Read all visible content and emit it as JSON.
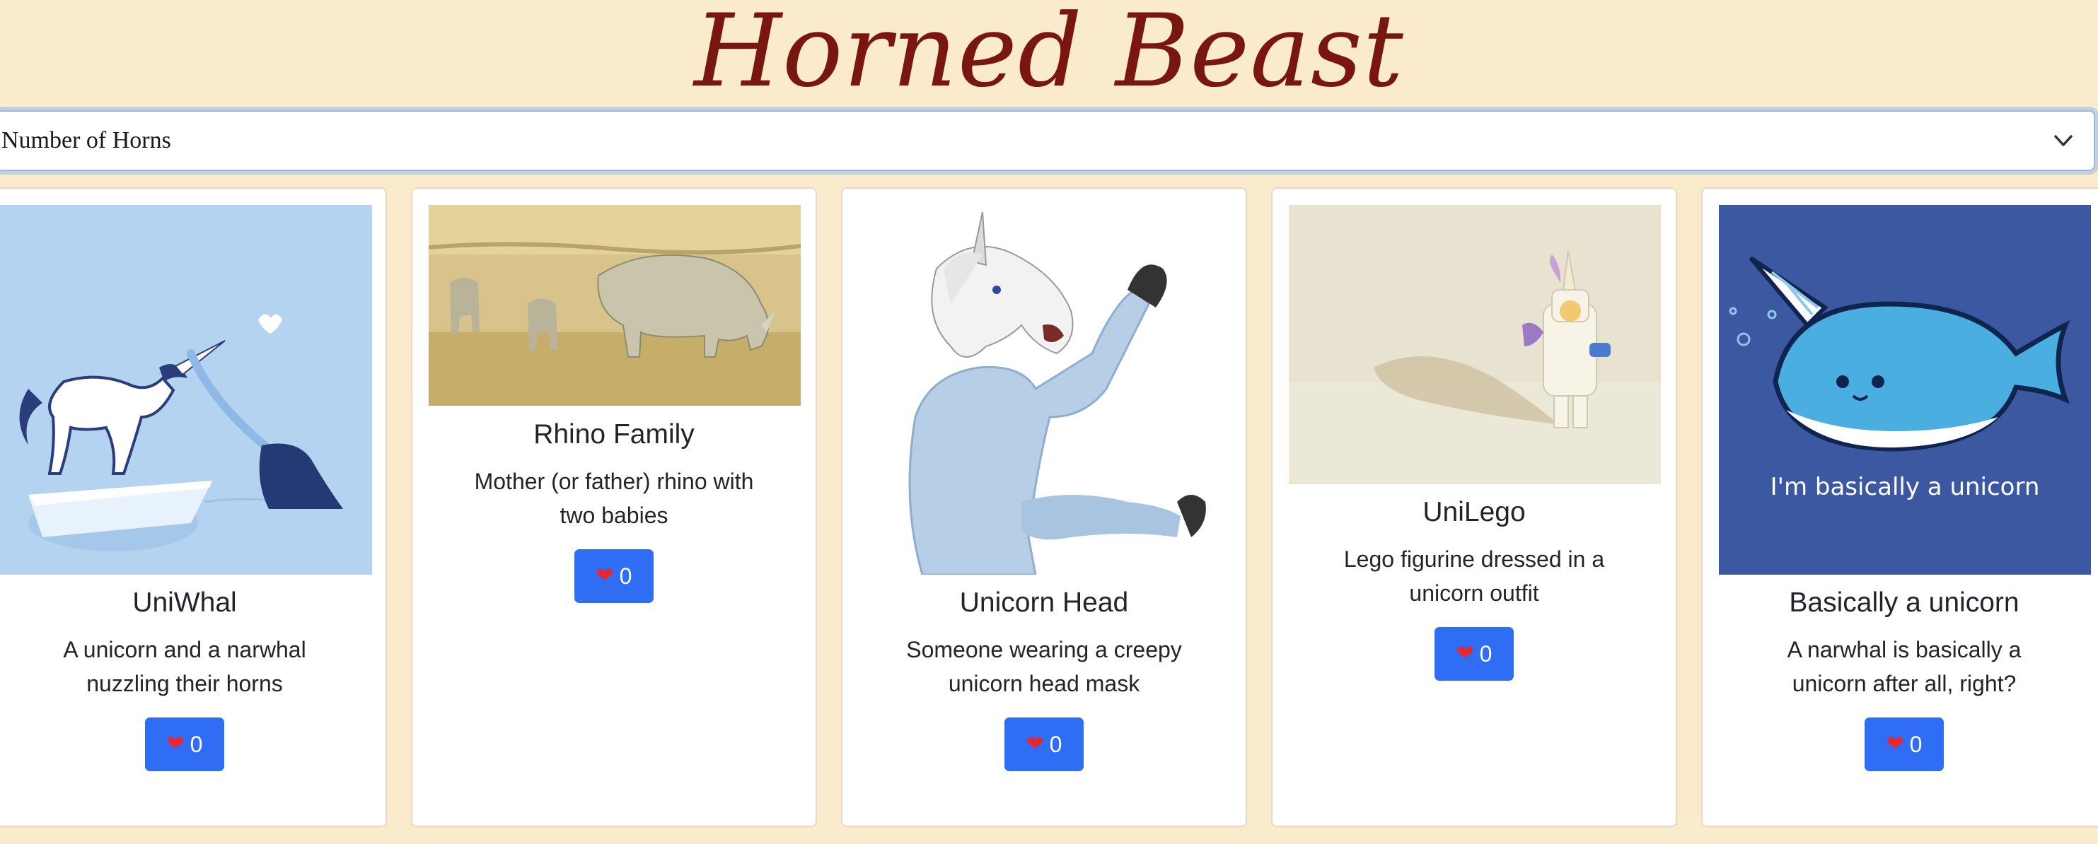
{
  "header": {
    "title": "Horned Beast"
  },
  "filter": {
    "selected": "Number of Horns",
    "icon": "chevron-down-icon"
  },
  "colors": {
    "background": "#fbebcd",
    "title": "#7a1610",
    "button": "#2f6df5",
    "heart": "#e8262e"
  },
  "beasts": [
    {
      "title": "UniWhal",
      "description": "A unicorn and a narwhal nuzzling their horns",
      "votes": "0"
    },
    {
      "title": "Rhino Family",
      "description": "Mother (or father) rhino with two babies",
      "votes": "0"
    },
    {
      "title": "Unicorn Head",
      "description": "Someone wearing a creepy unicorn head mask",
      "votes": "0"
    },
    {
      "title": "UniLego",
      "description": "Lego figurine dressed in a unicorn outfit",
      "votes": "0"
    },
    {
      "title": "Basically a unicorn",
      "description": "A narwhal is basically a unicorn after all, right?",
      "votes": "0",
      "image_text": "I'm basically a unicorn"
    }
  ],
  "vote_icon": "heart-icon",
  "heart_glyph": "❤"
}
